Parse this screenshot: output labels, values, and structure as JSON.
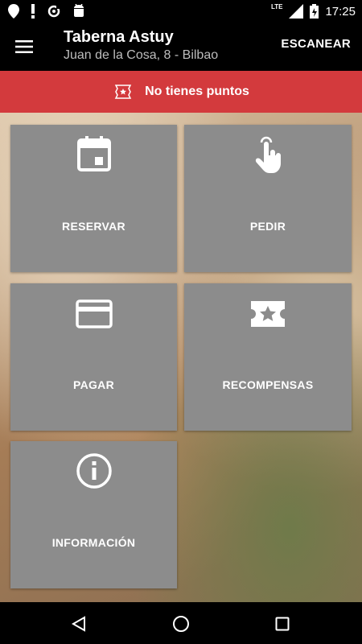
{
  "status_bar": {
    "time": "17:25",
    "network": "LTE",
    "icons": [
      "location-icon",
      "alert-icon",
      "sync-icon",
      "android-icon",
      "signal-icon",
      "battery-icon"
    ]
  },
  "app_bar": {
    "title": "Taberna Astuy",
    "subtitle": "Juan de la Cosa, 8 - Bilbao",
    "action_label": "ESCANEAR"
  },
  "points_banner": {
    "text": "No tienes puntos",
    "color": "#d33a3d"
  },
  "tiles": [
    {
      "label": "RESERVAR",
      "icon": "calendar-icon"
    },
    {
      "label": "PEDIR",
      "icon": "touch-icon"
    },
    {
      "label": "PAGAR",
      "icon": "credit-card-icon"
    },
    {
      "label": "RECOMPENSAS",
      "icon": "ticket-star-icon"
    },
    {
      "label": "INFORMACIÓN",
      "icon": "info-icon"
    }
  ],
  "colors": {
    "tile_bg": "#8c8c8c",
    "bar_bg": "#000000"
  }
}
